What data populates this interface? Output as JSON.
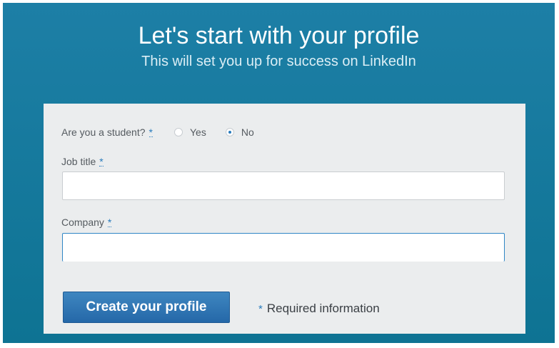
{
  "header": {
    "title": "Let's start with your profile",
    "subtitle": "This will set you up for success on LinkedIn"
  },
  "form": {
    "student_question": "Are you a student?",
    "required_marker": "*",
    "student_options": [
      {
        "label": "Yes",
        "selected": false
      },
      {
        "label": "No",
        "selected": true
      }
    ],
    "job_title": {
      "label": "Job title",
      "value": "",
      "placeholder": ""
    },
    "company": {
      "label": "Company",
      "value": "",
      "placeholder": ""
    },
    "submit_label": "Create your profile",
    "required_note": "Required information"
  },
  "colors": {
    "background": "#14789b",
    "accent": "#287bbc",
    "card": "#ebedee",
    "button": "#2f72b2"
  }
}
